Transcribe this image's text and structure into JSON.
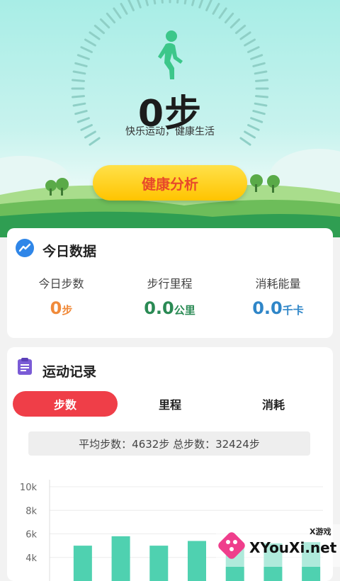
{
  "hero": {
    "steps_value": "0步",
    "slogan": "快乐运动，健康生活",
    "button_label": "健康分析"
  },
  "today": {
    "title": "今日数据",
    "stats": [
      {
        "label": "今日步数",
        "value": "0",
        "unit": "步",
        "color": "#f08a3a"
      },
      {
        "label": "步行里程",
        "value": "0.0",
        "unit": "公里",
        "color": "#2a8a54"
      },
      {
        "label": "消耗能量",
        "value": "0.0",
        "unit": "千卡",
        "color": "#2f86c8"
      }
    ]
  },
  "record": {
    "title": "运动记录",
    "tabs": [
      "步数",
      "里程",
      "消耗"
    ],
    "active_tab": 0,
    "summary": "平均步数：4632步 总步数：32424步"
  },
  "chart_data": {
    "type": "bar",
    "categories": [
      "",
      "",
      "",
      "",
      "",
      "",
      ""
    ],
    "values": [
      5000,
      5800,
      5000,
      5400,
      4800,
      5200,
      5300
    ],
    "y_ticks": [
      "10k",
      "8k",
      "6k",
      "4k"
    ],
    "ylim": [
      2000,
      10000
    ],
    "bar_color": "#4fd1b0"
  },
  "watermark": {
    "brand_top": "X游戏",
    "brand": "XYouXi.net"
  },
  "colors": {
    "accent_red": "#ef3e48",
    "button_yellow": "#ffcf1f",
    "button_text": "#e84a2a",
    "walker_green": "#3cc78a"
  }
}
